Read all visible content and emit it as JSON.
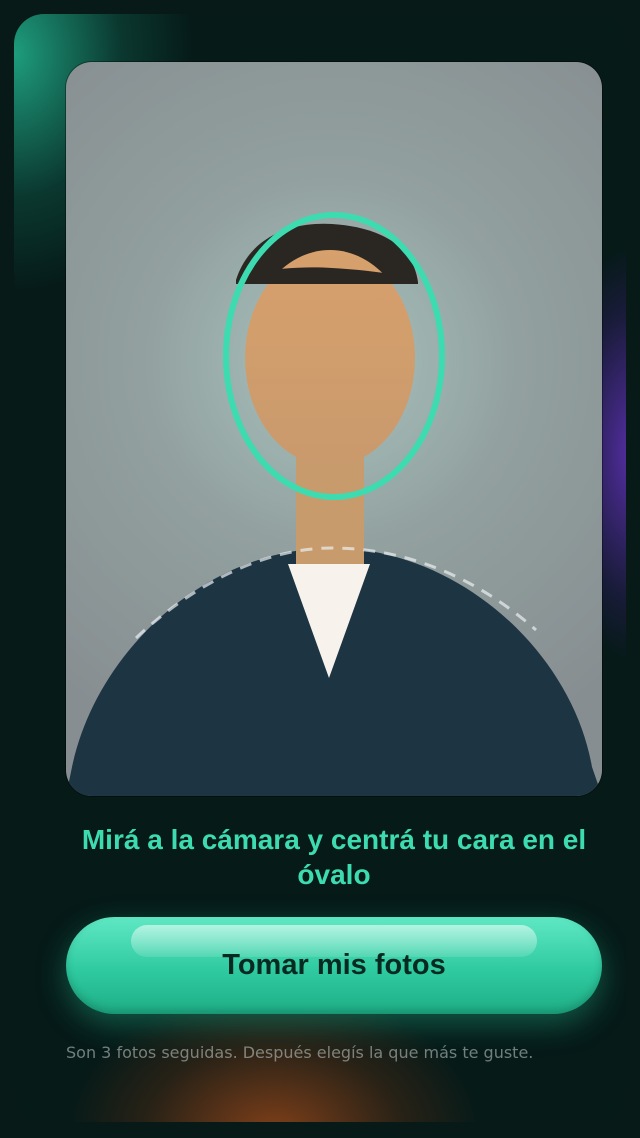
{
  "camera": {
    "face_guide_color": "#3ddbb0",
    "icons": [
      "person-silhouette",
      "face-oval-guide",
      "shoulder-guide"
    ]
  },
  "instructions": {
    "text": "Mirá a la cámara y centrá tu cara en el óvalo"
  },
  "primary_action": {
    "label": "Tomar mis fotos"
  },
  "note": {
    "text": "Son 3 fotos seguidas. Después elegís la que más te guste."
  },
  "colors": {
    "accent": "#3ddbb0",
    "button_text": "#062a22",
    "background": "#061a18"
  }
}
